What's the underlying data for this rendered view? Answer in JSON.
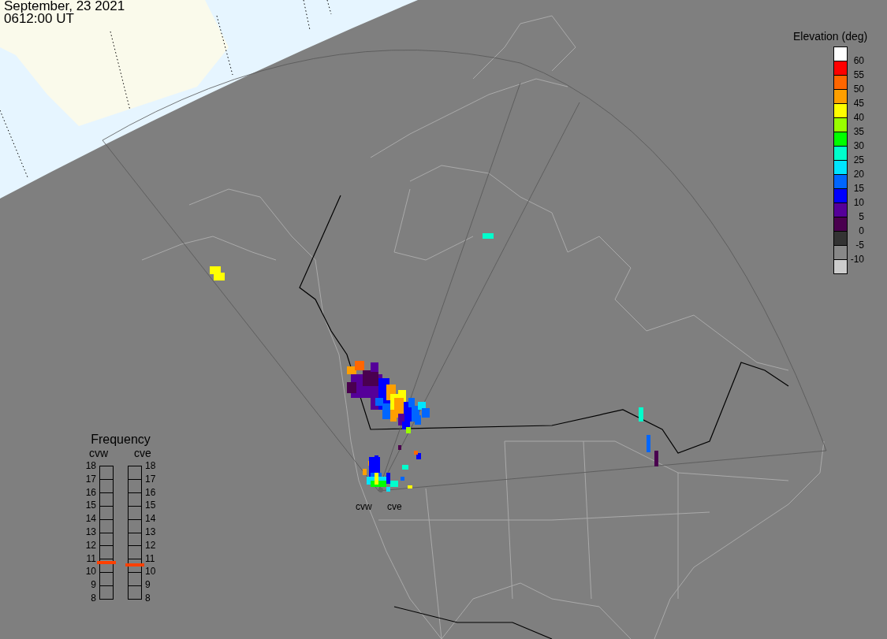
{
  "timestamp": {
    "date": "September, 23 2021",
    "time": "0612:00 UT"
  },
  "elevation_legend": {
    "title": "Elevation (deg)",
    "bins": [
      {
        "color": "#ffffff"
      },
      {
        "color": "#ff0000"
      },
      {
        "color": "#ff6600"
      },
      {
        "color": "#ff9f00"
      },
      {
        "color": "#ffff00"
      },
      {
        "color": "#99ff00"
      },
      {
        "color": "#00ff00"
      },
      {
        "color": "#00ffcc"
      },
      {
        "color": "#00e5ff"
      },
      {
        "color": "#0066ff"
      },
      {
        "color": "#0000ff"
      },
      {
        "color": "#550099"
      },
      {
        "color": "#4a004f"
      },
      {
        "color": "#333333"
      },
      {
        "color": "#888888"
      },
      {
        "color": "#cccccc"
      }
    ],
    "ticks": [
      "60",
      "55",
      "50",
      "45",
      "40",
      "35",
      "30",
      "25",
      "20",
      "15",
      "10",
      "5",
      "0",
      "-5",
      "-10"
    ]
  },
  "frequency": {
    "title": "Frequency",
    "radars": [
      {
        "name": "cvw",
        "level": 0.26,
        "ticks": [
          "18",
          "17",
          "16",
          "15",
          "14",
          "13",
          "12",
          "11",
          "10",
          "9",
          "8"
        ]
      },
      {
        "name": "cve",
        "level": 0.245,
        "ticks": [
          "18",
          "17",
          "16",
          "15",
          "14",
          "13",
          "12",
          "11",
          "10",
          "9",
          "8"
        ]
      }
    ]
  },
  "map": {
    "sites": [
      {
        "label": "cvw"
      },
      {
        "label": "cve"
      }
    ]
  }
}
